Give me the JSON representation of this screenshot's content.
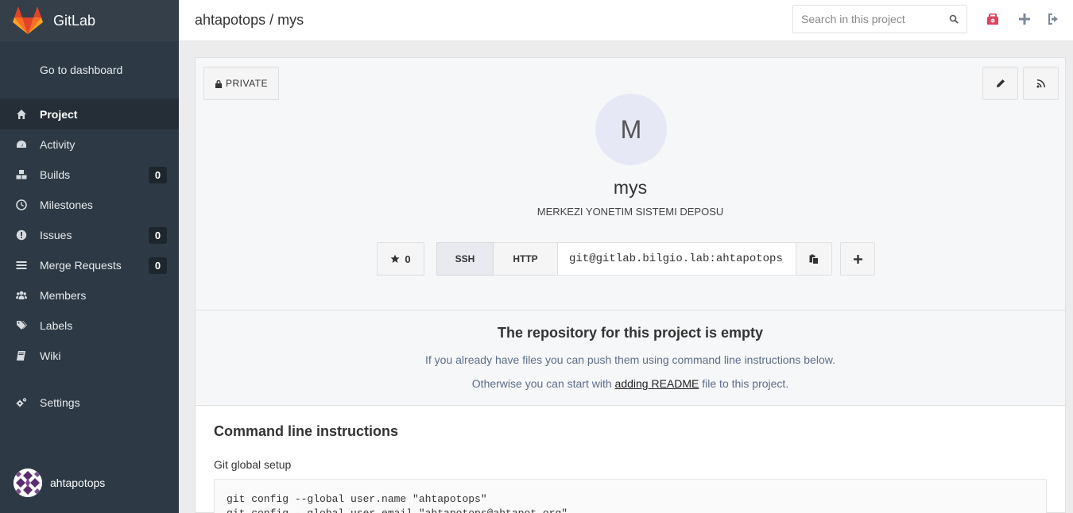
{
  "sidebar": {
    "brand": "GitLab",
    "dashboard": "Go to dashboard",
    "items": [
      {
        "label": "Project",
        "icon": "home-icon",
        "active": true
      },
      {
        "label": "Activity",
        "icon": "dashboard-icon"
      },
      {
        "label": "Builds",
        "icon": "cubes-icon",
        "badge": "0"
      },
      {
        "label": "Milestones",
        "icon": "clock-icon"
      },
      {
        "label": "Issues",
        "icon": "exclamation-circle-icon",
        "badge": "0"
      },
      {
        "label": "Merge Requests",
        "icon": "list-icon",
        "badge": "0"
      },
      {
        "label": "Members",
        "icon": "users-icon"
      },
      {
        "label": "Labels",
        "icon": "tags-icon"
      },
      {
        "label": "Wiki",
        "icon": "book-icon"
      }
    ],
    "settings": {
      "label": "Settings",
      "icon": "cogs-icon"
    },
    "user": "ahtapotops"
  },
  "header": {
    "title": "ahtapotops / mys",
    "search_placeholder": "Search in this project"
  },
  "project": {
    "visibility": "PRIVATE",
    "avatar_letter": "M",
    "name": "mys",
    "description": "MERKEZI YONETIM SISTEMI DEPOSU",
    "stars": "0",
    "clone": {
      "ssh_label": "SSH",
      "http_label": "HTTP",
      "url": "git@gitlab.bilgio.lab:ahtapotops"
    }
  },
  "empty": {
    "title": "The repository for this project is empty",
    "line1": "If you already have files you can push them using command line instructions below.",
    "line2_prefix": "Otherwise you can start with",
    "line2_link": "adding README",
    "line2_suffix": "file to this project."
  },
  "cli": {
    "title": "Command line instructions",
    "global_setup": "Git global setup",
    "code_line1": "git config --global user.name \"ahtapotops\"",
    "code_line2": "git config --global user.email \"ahtapotops@ahtapot.org\""
  },
  "colors": {
    "sidebar_bg": "#2d3a45",
    "sidebar_active": "#252e36",
    "accent_orange": "#fc6d26",
    "header_alert": "#e23f5b"
  }
}
